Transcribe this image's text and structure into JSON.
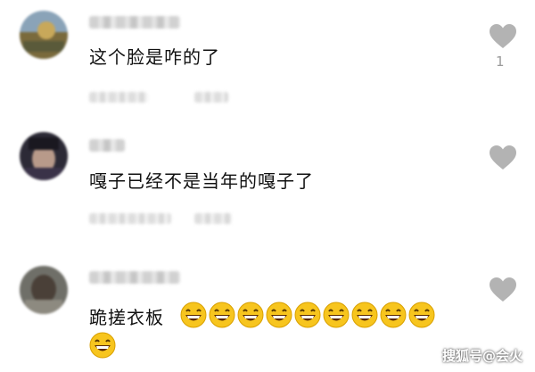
{
  "comments": [
    {
      "text": "这个脸是咋的了",
      "like_count": "1",
      "emoji_count": 0
    },
    {
      "text": "嘎子已经不是当年的嘎子了",
      "like_count": "",
      "emoji_count": 0
    },
    {
      "text": "跪搓衣板",
      "like_count": "",
      "emoji_count": 10
    }
  ],
  "icons": {
    "heart": "heart-icon",
    "emoji": "grinning-emoji-icon"
  },
  "colors": {
    "heart": "#b3b3b3",
    "text": "#111111",
    "meta": "#9a9a9a"
  },
  "watermark": "搜狐号@会火"
}
